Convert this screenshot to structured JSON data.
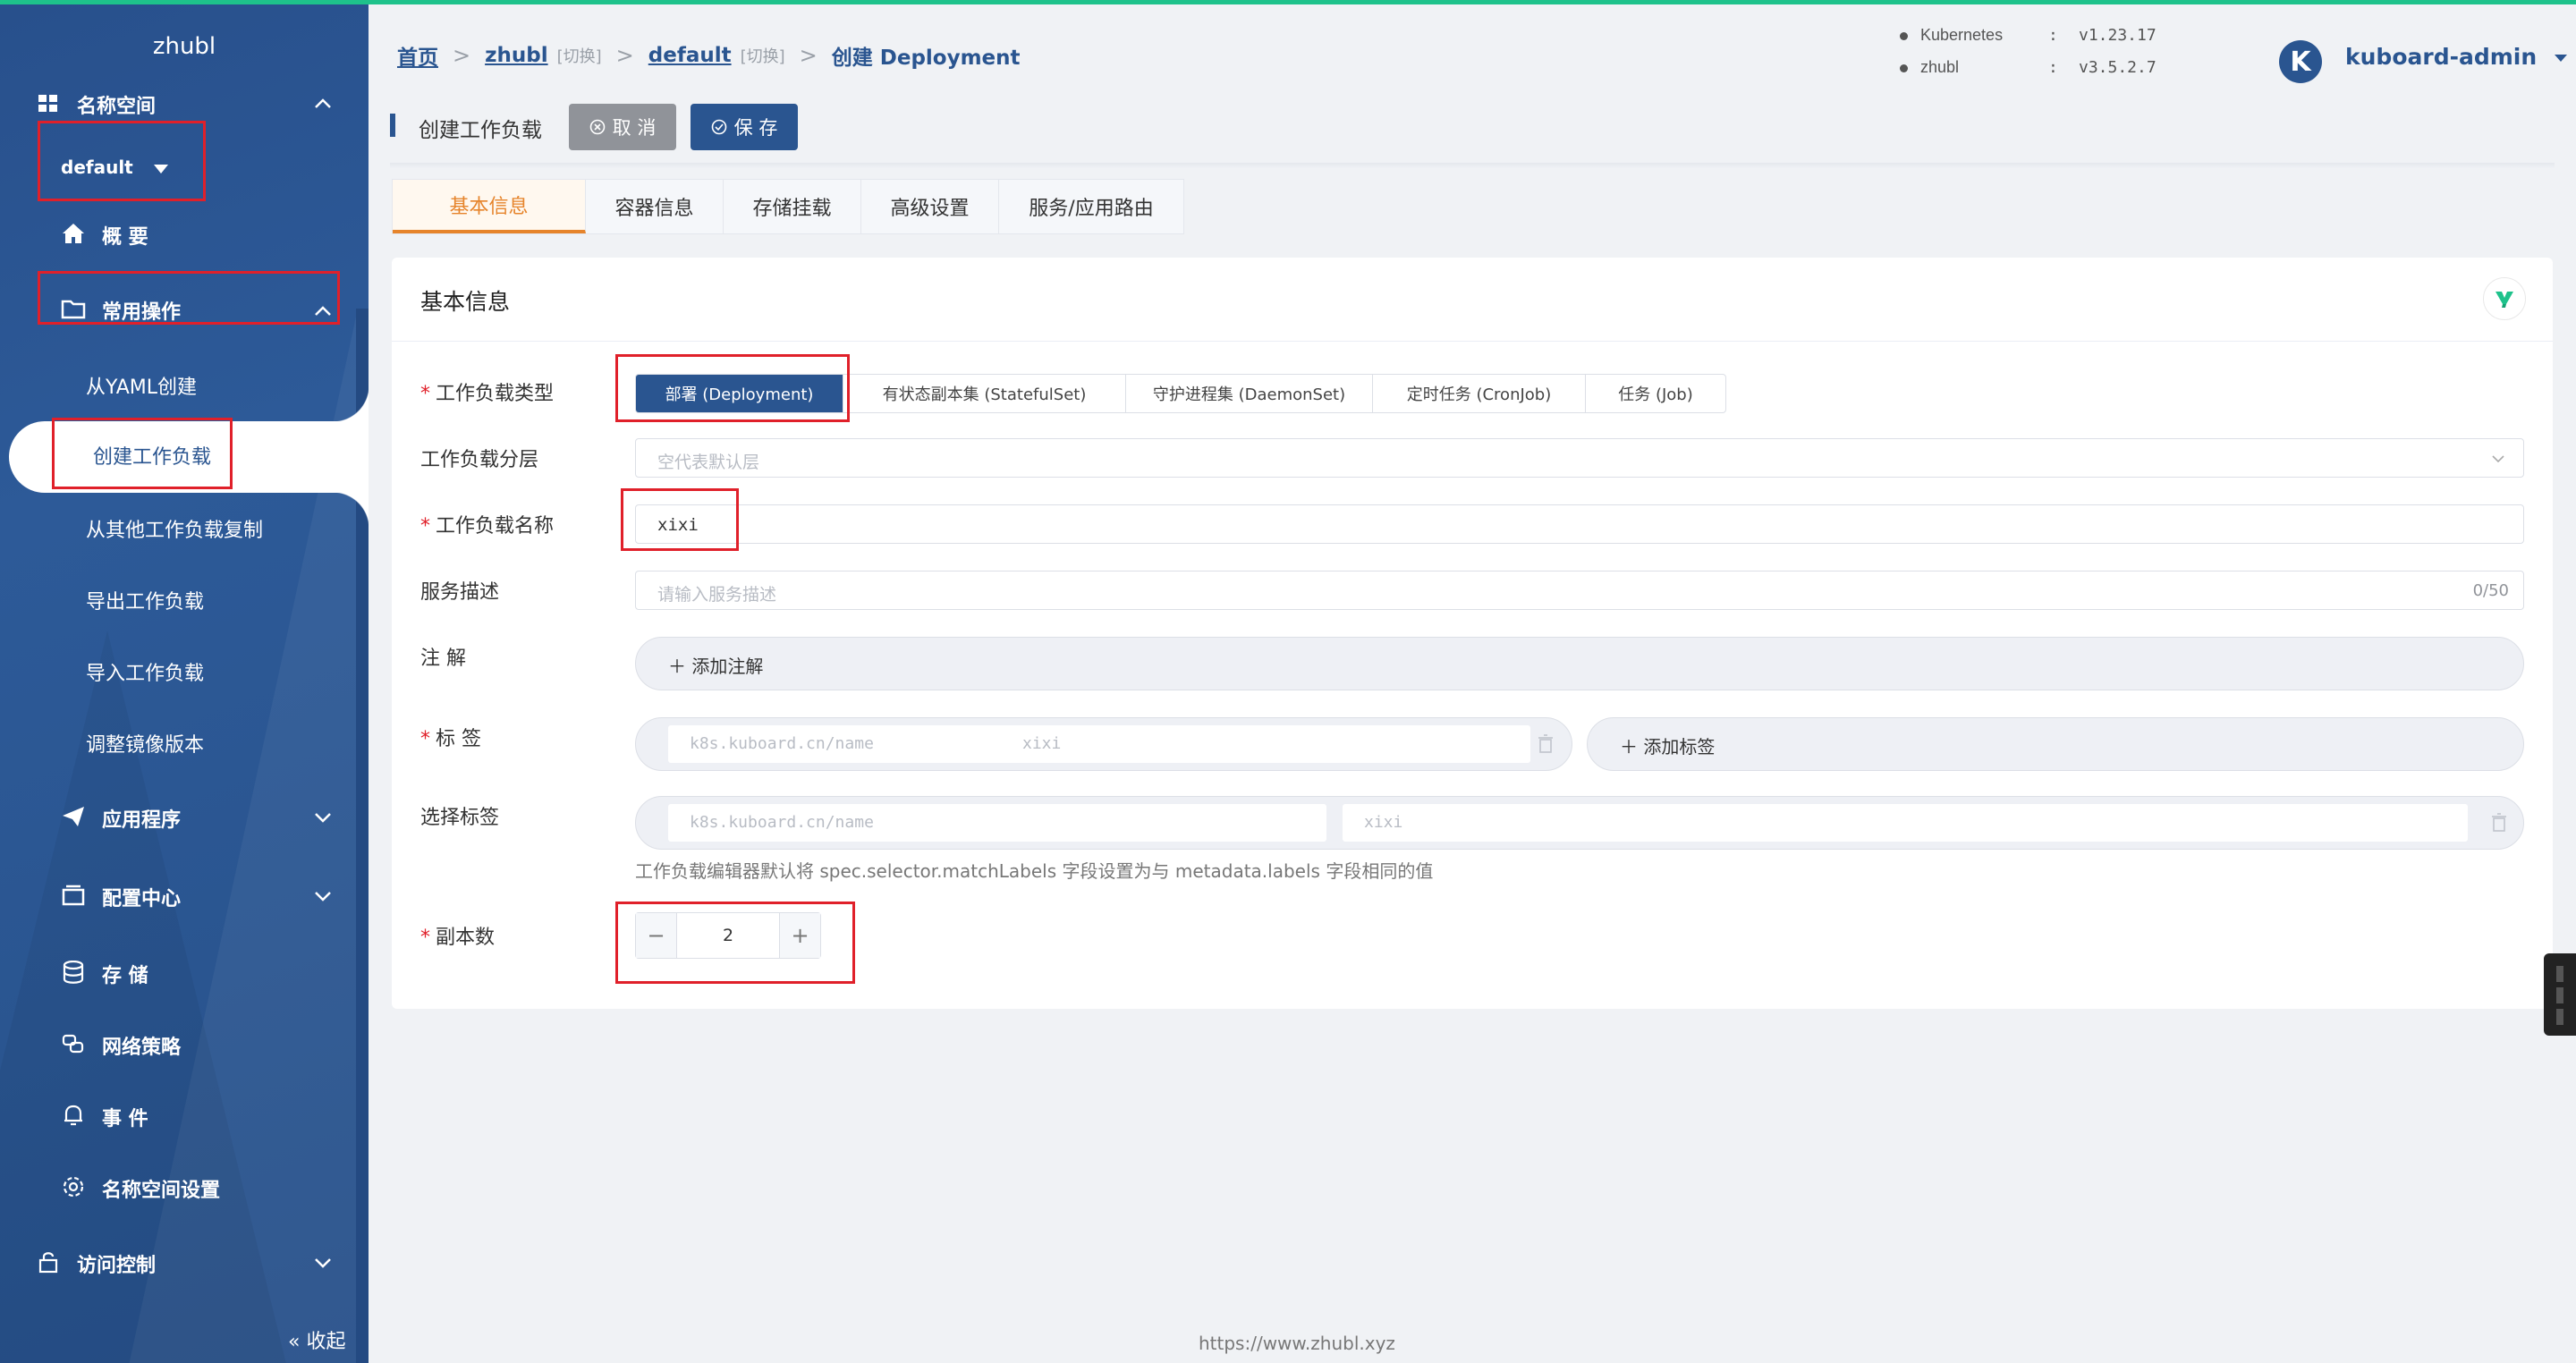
{
  "sidebar": {
    "cluster_name": "zhubl",
    "namespace_section": "名称空间",
    "namespace_value": "default",
    "overview": "概 要",
    "common_ops": "常用操作",
    "sub_items": [
      "从YAML创建",
      "创建工作负载",
      "从其他工作负载复制",
      "导出工作负载",
      "导入工作负载",
      "调整镜像版本"
    ],
    "apps": "应用程序",
    "config": "配置中心",
    "storage": "存 储",
    "netpolicy": "网络策略",
    "events": "事 件",
    "ns_settings": "名称空间设置",
    "access": "访问控制",
    "collapse": "« 收起"
  },
  "header": {
    "home": "首页",
    "cluster": "zhubl",
    "switch1": "[切换]",
    "namespace": "default",
    "switch2": "[切换]",
    "current": "创建 Deployment",
    "k8s_label": "Kubernetes",
    "k8s_sep": ":",
    "k8s_version": "v1.23.17",
    "kb_label": "zhubl",
    "kb_sep": ":",
    "kb_version": "v3.5.2.7",
    "avatar_letter": "K",
    "user": "kuboard-admin"
  },
  "toolbar": {
    "title": "创建工作负载",
    "cancel": "取 消",
    "save": "保 存"
  },
  "tabs": [
    "基本信息",
    "容器信息",
    "存储挂载",
    "高级设置",
    "服务/应用路由"
  ],
  "form": {
    "card_title": "基本信息",
    "type_label": "工作负载类型",
    "types": [
      "部署 (Deployment)",
      "有状态副本集 (StatefulSet)",
      "守护进程集 (DaemonSet)",
      "定时任务 (CronJob)",
      "任务 (Job)"
    ],
    "layer_label": "工作负载分层",
    "layer_placeholder": "空代表默认层",
    "name_label": "工作负载名称",
    "name_value": "xixi",
    "desc_label": "服务描述",
    "desc_placeholder": "请输入服务描述",
    "desc_count": "0/50",
    "annot_label": "注 解",
    "annot_add": "＋ 添加注解",
    "labels_label": "标 签",
    "label_key_ph": "k8s.kuboard.cn/name",
    "label_val_ph": "xixi",
    "labels_add": "＋ 添加标签",
    "selector_label": "选择标签",
    "selector_key_ph": "k8s.kuboard.cn/name",
    "selector_val_ph": "xixi",
    "selector_hint": "工作负载编辑器默认将 spec.selector.matchLabels 字段设置为与 metadata.labels 字段相同的值",
    "replicas_label": "副本数",
    "replicas_minus": "−",
    "replicas_value": "2",
    "replicas_plus": "+"
  },
  "footer": "https://www.zhubl.xyz",
  "colors": {
    "primary": "#2a5590",
    "accent": "#e6842b",
    "highlight": "#e0202a",
    "top_line": "#1ec28b"
  }
}
